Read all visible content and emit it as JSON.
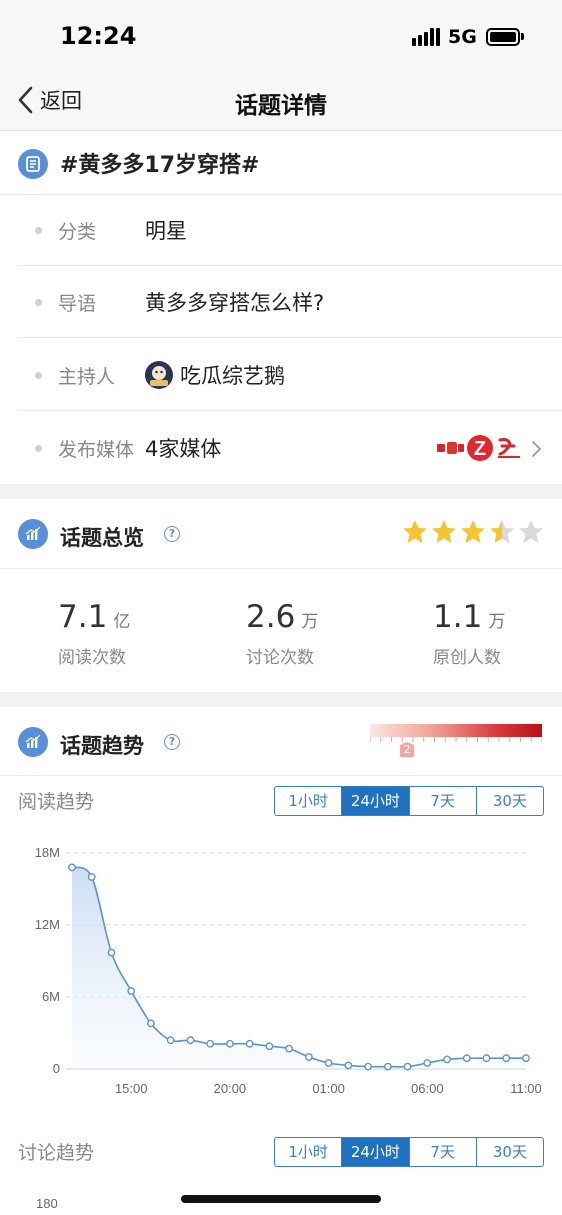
{
  "status_bar": {
    "time": "12:24",
    "network": "5G"
  },
  "nav": {
    "back_label": "返回",
    "title": "话题详情"
  },
  "topic": {
    "title": "#黄多多17岁穿搭#",
    "rows": [
      {
        "label": "分类",
        "value": "明星"
      },
      {
        "label": "导语",
        "value": "黄多多穿搭怎么样?"
      },
      {
        "label": "主持人",
        "value": "吃瓜综艺鹅"
      },
      {
        "label": "发布媒体",
        "value": "4家媒体"
      }
    ]
  },
  "overview": {
    "title": "话题总览",
    "rating": 3.5,
    "rating_max": 5,
    "stats": [
      {
        "value": "7.1",
        "unit": "亿",
        "label": "阅读次数"
      },
      {
        "value": "2.6",
        "unit": "万",
        "label": "讨论次数"
      },
      {
        "value": "1.1",
        "unit": "万",
        "label": "原创人数"
      }
    ]
  },
  "trend": {
    "title": "话题趋势",
    "heat_level": "2",
    "read_label": "阅读趋势",
    "discuss_label": "讨论趋势",
    "ranges": [
      "1小时",
      "24小时",
      "7天",
      "30天"
    ],
    "active_range": "24小时"
  },
  "chart_data": [
    {
      "type": "area",
      "title": "阅读趋势",
      "x_tick_labels": [
        "15:00",
        "20:00",
        "01:00",
        "06:00",
        "11:00"
      ],
      "y_tick_labels": [
        "0",
        "6M",
        "12M",
        "18M"
      ],
      "ylim": [
        0,
        18000000
      ],
      "grid": true,
      "color": "#5b93cf",
      "values": [
        16800000,
        16000000,
        9700000,
        6500000,
        3800000,
        2400000,
        2400000,
        2100000,
        2100000,
        2100000,
        1900000,
        1700000,
        1000000,
        500000,
        300000,
        200000,
        200000,
        200000,
        500000,
        800000,
        900000,
        900000,
        900000,
        900000
      ]
    },
    {
      "type": "line",
      "title": "讨论趋势",
      "y_tick_labels": [
        "180"
      ],
      "values": []
    }
  ]
}
